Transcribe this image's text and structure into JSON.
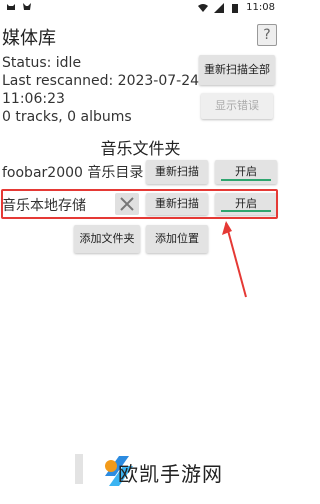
{
  "statusbar": {
    "time": "11:08"
  },
  "header": {
    "title": "媒体库",
    "help_label": "?"
  },
  "info": {
    "status": "Status: idle",
    "last_rescanned": "Last rescanned: 2023-07-24",
    "last_rescanned_time": "11:06:23",
    "counts": "0 tracks, 0 albums"
  },
  "actions": {
    "rescan_all": "重新扫描全部",
    "show_errors": "显示错误"
  },
  "folders": {
    "title": "音乐文件夹",
    "items": [
      {
        "label": "foobar2000 音乐目录",
        "rescan": "重新扫描",
        "toggle": "开启"
      },
      {
        "label": "音乐本地存储",
        "rescan": "重新扫描",
        "toggle": "开启"
      }
    ],
    "add_folder": "添加文件夹",
    "add_location": "添加位置"
  },
  "watermark": {
    "text": "欧凯手游网"
  },
  "colors": {
    "highlight": "#e53935",
    "toggle_underline": "#2fa56f"
  }
}
